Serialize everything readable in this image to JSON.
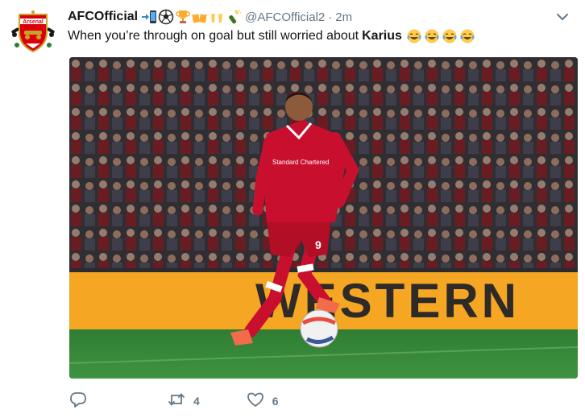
{
  "tweet": {
    "display_name": "AFCOfficial",
    "handle": "@AFCOfficial2",
    "separator": "·",
    "time": "2m",
    "text_prefix": "When you’re through on goal but still worried about",
    "text_bold": "Karius",
    "avatar_label": "Arsenal",
    "name_emojis": [
      "mobile-phone-arrow-icon",
      "soccer-ball-icon",
      "trophy-icon",
      "beer-mugs-icon",
      "clinking-beer-icon",
      "champagne-icon"
    ],
    "text_emojis": [
      "tears-of-joy-icon",
      "tears-of-joy-icon",
      "tears-of-joy-icon",
      "tears-of-joy-icon"
    ],
    "media": {
      "board_text": "WESTERN",
      "shirt_sponsor": "Standard Chartered",
      "shirt_number": "9"
    },
    "actions": {
      "reply_count": "",
      "retweet_count": "4",
      "like_count": "6"
    }
  },
  "colors": {
    "text": "#14171a",
    "secondary": "#657786",
    "liverpool_red": "#c8102e",
    "board_orange": "#f5a623",
    "pitch_green": "#3d8a3a",
    "arsenal_red": "#db0007"
  }
}
